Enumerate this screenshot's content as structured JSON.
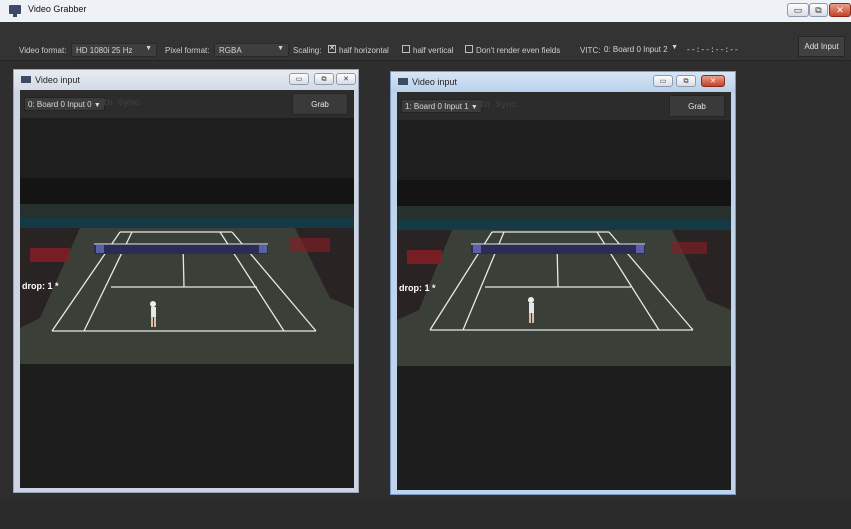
{
  "window": {
    "title": "Video Grabber",
    "min": "▭",
    "max": "⧉",
    "close": "✕"
  },
  "toolbar": {
    "video_format_label": "Video format:",
    "video_format_value": "HD 1080i 25 Hz",
    "pixel_format_label": "Pixel format:",
    "pixel_format_value": "RGBA",
    "scaling_label": "Scaling:",
    "half_horizontal_label": "half horizontal",
    "half_horizontal_checked": true,
    "half_vertical_label": "half vertical",
    "half_vertical_checked": false,
    "even_fields_label": "Don't render even fields",
    "even_fields_checked": false,
    "vitc_label": "VITC:",
    "vitc_value": "0: Board 0 Input 2",
    "timecode": "--:--:--:--",
    "add_input_label": "Add Input",
    "dropdown_icon": "chevron-down-icon"
  },
  "video_windows": [
    {
      "title": "Video input",
      "device": "0: Board 0 Input 0",
      "sync": "In Sync",
      "grab_label": "Grab",
      "drop_text": "drop: 1 *",
      "active": false
    },
    {
      "title": "Video input",
      "device": "1: Board 0 Input 1",
      "sync": "In Sync",
      "grab_label": "Grab",
      "drop_text": "drop: 1 *",
      "active": true
    }
  ],
  "colors": {
    "background": "#2e2e2e",
    "court": "#3a3f38",
    "stands_banner": "#163a45",
    "close_button": "#c7412b"
  }
}
